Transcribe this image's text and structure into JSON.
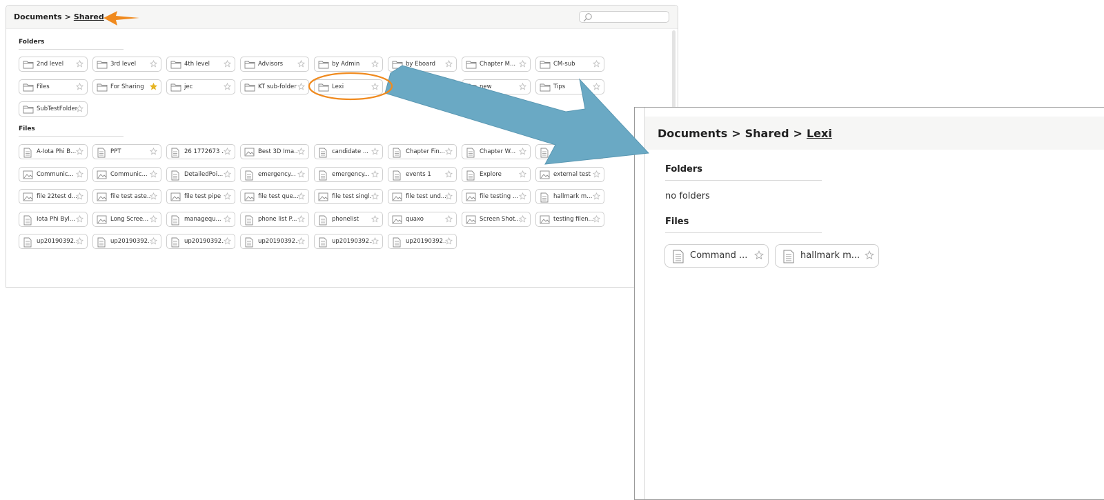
{
  "main": {
    "breadcrumb": {
      "root": "Documents",
      "separator": ">",
      "current": "Shared"
    },
    "folders_heading": "Folders",
    "files_heading": "Files",
    "folders": [
      {
        "label": "2nd level",
        "starred": false
      },
      {
        "label": "3rd level",
        "starred": false
      },
      {
        "label": "4th level",
        "starred": false
      },
      {
        "label": "Advisors",
        "starred": false
      },
      {
        "label": "by Admin",
        "starred": false
      },
      {
        "label": "by Eboard",
        "starred": false
      },
      {
        "label": "Chapter M...",
        "starred": false
      },
      {
        "label": "CM-sub",
        "starred": false
      },
      {
        "label": "Files",
        "starred": false
      },
      {
        "label": "For Sharing",
        "starred": true
      },
      {
        "label": "jec",
        "starred": false
      },
      {
        "label": "KT sub-folder",
        "starred": false
      },
      {
        "label": "Lexi",
        "starred": false
      },
      {
        "label": "",
        "starred": false
      },
      {
        "label": "new",
        "starred": false
      },
      {
        "label": "Tips",
        "starred": false
      },
      {
        "label": "SubTestFolder",
        "starred": false
      }
    ],
    "files": [
      {
        "label": "A-Iota Phi B...",
        "icon": "doc"
      },
      {
        "label": "PPT",
        "icon": "doc"
      },
      {
        "label": "26 1772673 ...",
        "icon": "doc"
      },
      {
        "label": "Best 3D Ima...",
        "icon": "image"
      },
      {
        "label": "candidate ...",
        "icon": "doc"
      },
      {
        "label": "Chapter Fin...",
        "icon": "doc"
      },
      {
        "label": "Chapter W...",
        "icon": "doc"
      },
      {
        "label": "",
        "icon": "doc"
      },
      {
        "label": "Communic...",
        "icon": "image"
      },
      {
        "label": "Communic...",
        "icon": "image"
      },
      {
        "label": "DetailedPoi...",
        "icon": "doc"
      },
      {
        "label": "emergency...",
        "icon": "doc"
      },
      {
        "label": "emergency...",
        "icon": "doc"
      },
      {
        "label": "events 1",
        "icon": "doc"
      },
      {
        "label": "Explore",
        "icon": "doc"
      },
      {
        "label": "external test",
        "icon": "image"
      },
      {
        "label": "file 22test d...",
        "icon": "image"
      },
      {
        "label": "file test aste...",
        "icon": "image"
      },
      {
        "label": "file test pipe",
        "icon": "image"
      },
      {
        "label": "file test que...",
        "icon": "image"
      },
      {
        "label": "file test singl...",
        "icon": "image"
      },
      {
        "label": "file test und...",
        "icon": "image"
      },
      {
        "label": "file testing ...",
        "icon": "image"
      },
      {
        "label": "hallmark m...",
        "icon": "doc"
      },
      {
        "label": "Iota Phi Byl...",
        "icon": "doc"
      },
      {
        "label": "Long Scree...",
        "icon": "image"
      },
      {
        "label": "managequ...",
        "icon": "doc"
      },
      {
        "label": "phone list P...",
        "icon": "doc"
      },
      {
        "label": "phonelist",
        "icon": "doc"
      },
      {
        "label": "quaxo",
        "icon": "image"
      },
      {
        "label": "Screen Shot...",
        "icon": "image"
      },
      {
        "label": "testing filen...",
        "icon": "image"
      },
      {
        "label": "up20190392...",
        "icon": "doc"
      },
      {
        "label": "up20190392...",
        "icon": "doc"
      },
      {
        "label": "up20190392...",
        "icon": "doc"
      },
      {
        "label": "up20190392...",
        "icon": "doc"
      },
      {
        "label": "up20190392...",
        "icon": "doc"
      },
      {
        "label": "up20190392...",
        "icon": "doc"
      }
    ]
  },
  "zoom": {
    "breadcrumb": {
      "root": "Documents",
      "separator": ">",
      "middle": "Shared",
      "current": "Lexi"
    },
    "folders_heading": "Folders",
    "no_folders": "no folders",
    "files_heading": "Files",
    "files": [
      {
        "label": "Command ..."
      },
      {
        "label": "hallmark m..."
      }
    ]
  },
  "colors": {
    "annotation_arrow": "#f08a1e",
    "annotation_circle": "#f08a1e",
    "transition_arrow": "#6aa9c4",
    "star_filled": "#e6b422"
  }
}
